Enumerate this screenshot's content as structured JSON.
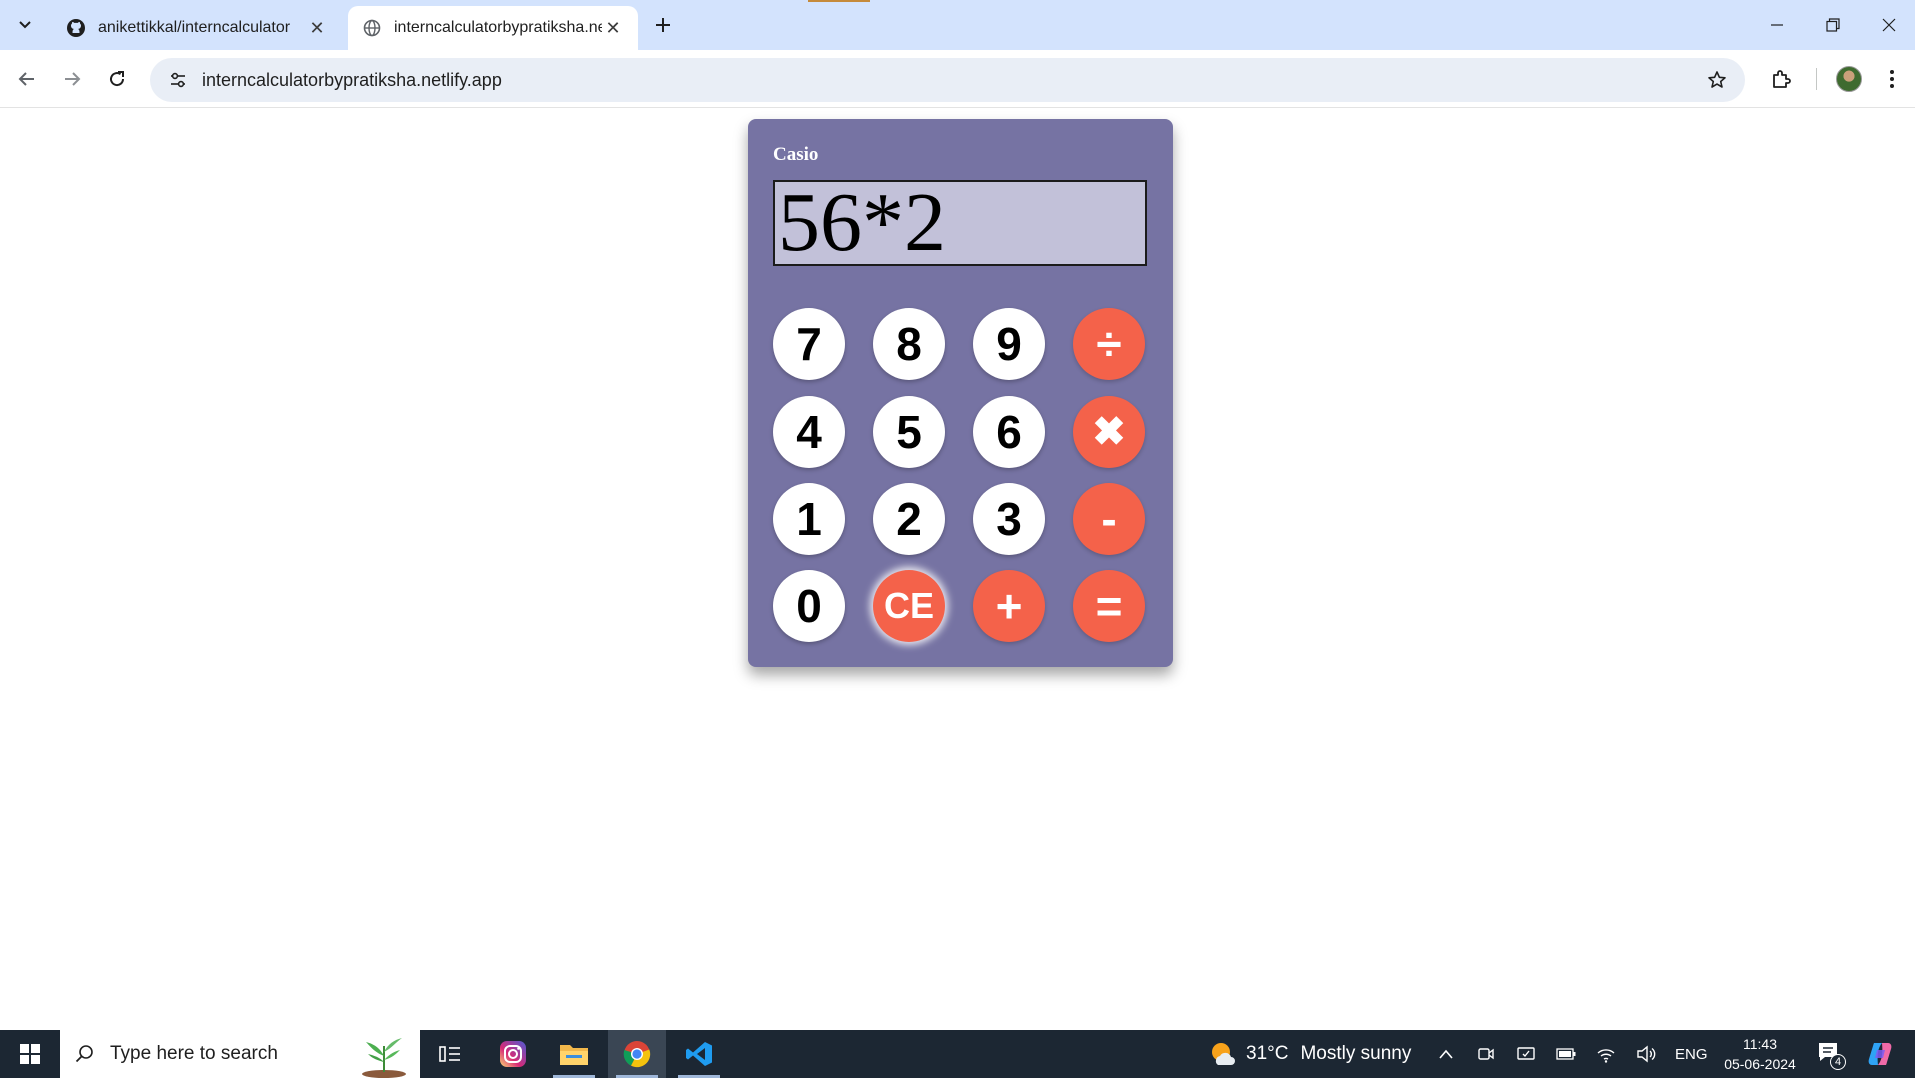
{
  "browser": {
    "tabs": [
      {
        "title": "anikettikkal/interncalculator",
        "active": false,
        "favicon": "github-icon"
      },
      {
        "title": "interncalculatorbypratiksha.netlify.app",
        "active": true,
        "favicon": "globe-icon"
      }
    ],
    "url": "interncalculatorbypratiksha.netlify.app"
  },
  "calculator": {
    "brand": "Casio",
    "display": "56*2",
    "keys": [
      [
        "7",
        "8",
        "9",
        "÷"
      ],
      [
        "4",
        "5",
        "6",
        "✖"
      ],
      [
        "1",
        "2",
        "3",
        "-"
      ],
      [
        "0",
        "CE",
        "+",
        "="
      ]
    ]
  },
  "taskbar": {
    "search_placeholder": "Type here to search",
    "weather": {
      "temp": "31°C",
      "condition": "Mostly sunny"
    },
    "language": "ENG",
    "time": "11:43",
    "date": "05-06-2024",
    "notification_count": "4"
  },
  "colors": {
    "calculator_body": "#7673a3",
    "display_bg": "#c2c1d9",
    "operator_key": "#f4624a",
    "number_key": "#ffffff",
    "taskbar": "#1c2733"
  }
}
